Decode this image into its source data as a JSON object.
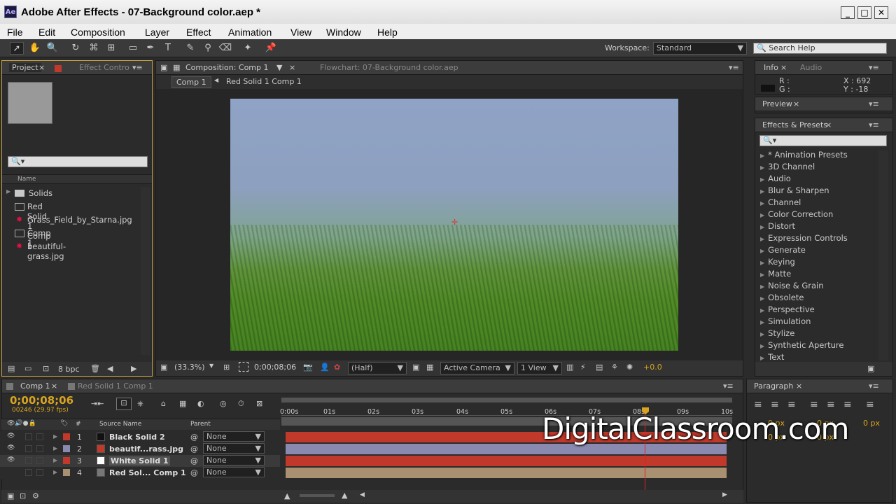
{
  "window": {
    "title": "Adobe After Effects - 07-Background color.aep *",
    "logo": "Ae"
  },
  "menu": [
    "File",
    "Edit",
    "Composition",
    "Layer",
    "Effect",
    "Animation",
    "View",
    "Window",
    "Help"
  ],
  "toolbar": {
    "workspace_label": "Workspace:",
    "workspace_value": "Standard",
    "search_placeholder": "Search Help"
  },
  "project": {
    "tab": "Project",
    "tab2": "Effect Contro",
    "col_name": "Name",
    "items": [
      "Solids",
      "Red Solid 1 Comp 1",
      "Grass_Field_by_Starna.jpg",
      "Comp 1",
      "beautiful-grass.jpg"
    ],
    "bpc": "8 bpc"
  },
  "comp": {
    "tab": "Composition: Comp 1",
    "flowchart_tab": "Flowchart: 07-Background color.aep",
    "breadcrumb1": "Comp 1",
    "breadcrumb2": "Red Solid 1 Comp 1",
    "zoom": "(33.3%)",
    "timecode": "0;00;08;06",
    "resolution": "(Half)",
    "camera": "Active Camera",
    "views": "1 View",
    "exposure": "+0.0"
  },
  "info": {
    "tab": "Info",
    "tab2": "Audio",
    "r": "R :",
    "g": "G :",
    "x": "X : 692",
    "y": "Y : -18"
  },
  "preview": {
    "tab": "Preview"
  },
  "effects": {
    "tab": "Effects & Presets",
    "items": [
      "* Animation Presets",
      "3D Channel",
      "Audio",
      "Blur & Sharpen",
      "Channel",
      "Color Correction",
      "Distort",
      "Expression Controls",
      "Generate",
      "Keying",
      "Matte",
      "Noise & Grain",
      "Obsolete",
      "Perspective",
      "Simulation",
      "Stylize",
      "Synthetic Aperture",
      "Text"
    ]
  },
  "timeline": {
    "tab1": "Comp 1",
    "tab2": "Red Solid 1 Comp 1",
    "timecode": "0;00;08;06",
    "fps": "00246 (29.97 fps)",
    "col_source": "Source Name",
    "col_parent": "Parent",
    "col_num": "#",
    "ticks": [
      "0:00s",
      "01s",
      "02s",
      "03s",
      "04s",
      "05s",
      "06s",
      "07s",
      "08s",
      "09s",
      "10s"
    ],
    "layers": [
      {
        "num": "1",
        "name": "Black Solid 2",
        "parent": "None",
        "color": "#c0392b",
        "swatch": "#111111"
      },
      {
        "num": "2",
        "name": "beautif...rass.jpg",
        "parent": "None",
        "color": "#8a8ab0",
        "swatch": "#c0392b"
      },
      {
        "num": "3",
        "name": "White Solid 1",
        "parent": "None",
        "color": "#c0392b",
        "swatch": "#ffffff"
      },
      {
        "num": "4",
        "name": "Red Sol... Comp 1",
        "parent": "None",
        "color": "#a89070",
        "swatch": "#777777"
      }
    ],
    "current_time_fraction": 0.825
  },
  "paragraph": {
    "tab": "Paragraph",
    "px1": "0 px",
    "px2": "0 px",
    "px3": "0 px",
    "px4": "0 px",
    "px5": "0 px"
  },
  "watermark": "DigitalClassroom.com"
}
